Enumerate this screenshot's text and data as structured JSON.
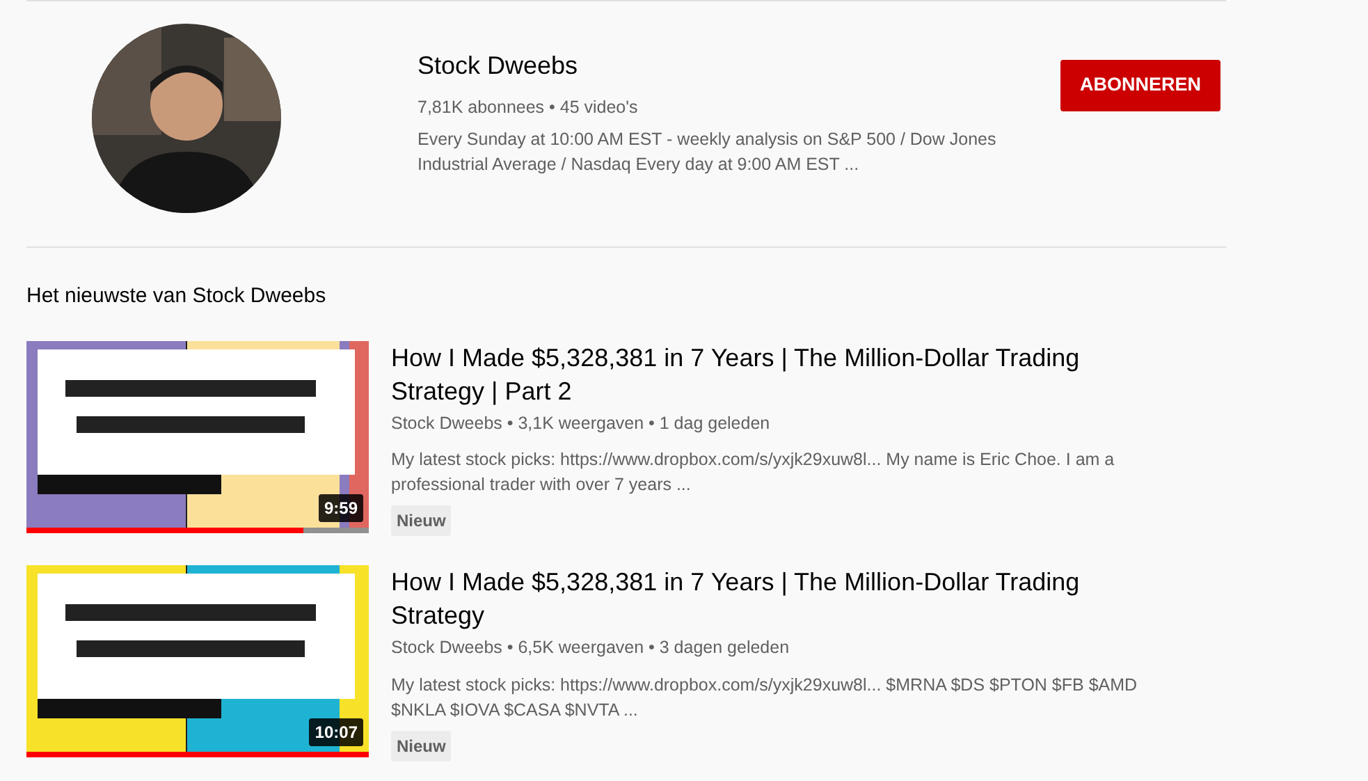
{
  "channel": {
    "name": "Stock Dweebs",
    "stats": "7,81K abonnees • 45 video's",
    "description": "Every Sunday at 10:00 AM EST - weekly analysis on S&P 500 / Dow Jones Industrial Average / Nasdaq Every day at 9:00 AM EST ...",
    "subscribe_button": "ABONNEREN"
  },
  "section_title": "Het nieuwste van Stock Dweebs",
  "videos": [
    {
      "title": "How I Made $5,328,381 in 7 Years | The Million-Dollar Trading Strategy | Part 2",
      "meta": "Stock Dweebs • 3,1K weergaven • 1 dag geleden",
      "description": "My latest stock picks: https://www.dropbox.com/s/yxjk29xuw8l... My name is Eric Choe. I am a professional trader with over 7 years ...",
      "badge": "Nieuw",
      "duration": "9:59",
      "level": 0.81
    },
    {
      "title": "How I Made $5,328,381 in 7 Years | The Million-Dollar Trading Strategy",
      "meta": "Stock Dweebs • 6,5K weergaven • 3 dagen geleden",
      "description": "My latest stock picks: https://www.dropbox.com/s/yxjk29xuw8l... $MRNA $DS $PTON $FB $AMD $NKLA $IOVA $CASA $NVTA ...",
      "badge": "Nieuw",
      "duration": "10:07",
      "level": 1
    }
  ]
}
